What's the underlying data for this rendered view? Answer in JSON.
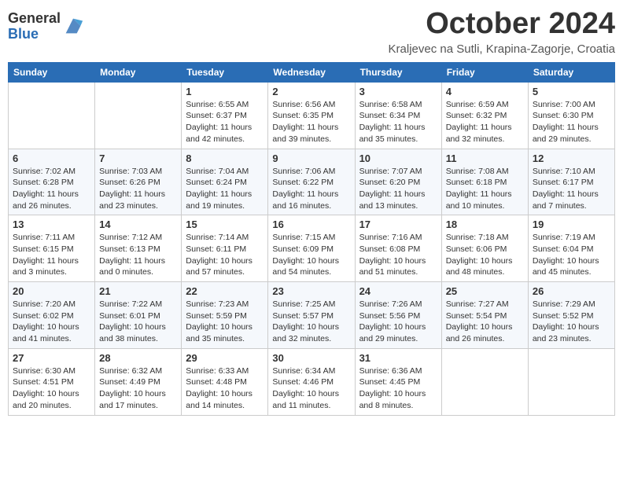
{
  "logo": {
    "general": "General",
    "blue": "Blue"
  },
  "title": "October 2024",
  "location": "Kraljevec na Sutli, Krapina-Zagorje, Croatia",
  "days_of_week": [
    "Sunday",
    "Monday",
    "Tuesday",
    "Wednesday",
    "Thursday",
    "Friday",
    "Saturday"
  ],
  "weeks": [
    [
      {
        "day": "",
        "info": ""
      },
      {
        "day": "",
        "info": ""
      },
      {
        "day": "1",
        "sunrise": "Sunrise: 6:55 AM",
        "sunset": "Sunset: 6:37 PM",
        "daylight": "Daylight: 11 hours and 42 minutes."
      },
      {
        "day": "2",
        "sunrise": "Sunrise: 6:56 AM",
        "sunset": "Sunset: 6:35 PM",
        "daylight": "Daylight: 11 hours and 39 minutes."
      },
      {
        "day": "3",
        "sunrise": "Sunrise: 6:58 AM",
        "sunset": "Sunset: 6:34 PM",
        "daylight": "Daylight: 11 hours and 35 minutes."
      },
      {
        "day": "4",
        "sunrise": "Sunrise: 6:59 AM",
        "sunset": "Sunset: 6:32 PM",
        "daylight": "Daylight: 11 hours and 32 minutes."
      },
      {
        "day": "5",
        "sunrise": "Sunrise: 7:00 AM",
        "sunset": "Sunset: 6:30 PM",
        "daylight": "Daylight: 11 hours and 29 minutes."
      }
    ],
    [
      {
        "day": "6",
        "sunrise": "Sunrise: 7:02 AM",
        "sunset": "Sunset: 6:28 PM",
        "daylight": "Daylight: 11 hours and 26 minutes."
      },
      {
        "day": "7",
        "sunrise": "Sunrise: 7:03 AM",
        "sunset": "Sunset: 6:26 PM",
        "daylight": "Daylight: 11 hours and 23 minutes."
      },
      {
        "day": "8",
        "sunrise": "Sunrise: 7:04 AM",
        "sunset": "Sunset: 6:24 PM",
        "daylight": "Daylight: 11 hours and 19 minutes."
      },
      {
        "day": "9",
        "sunrise": "Sunrise: 7:06 AM",
        "sunset": "Sunset: 6:22 PM",
        "daylight": "Daylight: 11 hours and 16 minutes."
      },
      {
        "day": "10",
        "sunrise": "Sunrise: 7:07 AM",
        "sunset": "Sunset: 6:20 PM",
        "daylight": "Daylight: 11 hours and 13 minutes."
      },
      {
        "day": "11",
        "sunrise": "Sunrise: 7:08 AM",
        "sunset": "Sunset: 6:18 PM",
        "daylight": "Daylight: 11 hours and 10 minutes."
      },
      {
        "day": "12",
        "sunrise": "Sunrise: 7:10 AM",
        "sunset": "Sunset: 6:17 PM",
        "daylight": "Daylight: 11 hours and 7 minutes."
      }
    ],
    [
      {
        "day": "13",
        "sunrise": "Sunrise: 7:11 AM",
        "sunset": "Sunset: 6:15 PM",
        "daylight": "Daylight: 11 hours and 3 minutes."
      },
      {
        "day": "14",
        "sunrise": "Sunrise: 7:12 AM",
        "sunset": "Sunset: 6:13 PM",
        "daylight": "Daylight: 11 hours and 0 minutes."
      },
      {
        "day": "15",
        "sunrise": "Sunrise: 7:14 AM",
        "sunset": "Sunset: 6:11 PM",
        "daylight": "Daylight: 10 hours and 57 minutes."
      },
      {
        "day": "16",
        "sunrise": "Sunrise: 7:15 AM",
        "sunset": "Sunset: 6:09 PM",
        "daylight": "Daylight: 10 hours and 54 minutes."
      },
      {
        "day": "17",
        "sunrise": "Sunrise: 7:16 AM",
        "sunset": "Sunset: 6:08 PM",
        "daylight": "Daylight: 10 hours and 51 minutes."
      },
      {
        "day": "18",
        "sunrise": "Sunrise: 7:18 AM",
        "sunset": "Sunset: 6:06 PM",
        "daylight": "Daylight: 10 hours and 48 minutes."
      },
      {
        "day": "19",
        "sunrise": "Sunrise: 7:19 AM",
        "sunset": "Sunset: 6:04 PM",
        "daylight": "Daylight: 10 hours and 45 minutes."
      }
    ],
    [
      {
        "day": "20",
        "sunrise": "Sunrise: 7:20 AM",
        "sunset": "Sunset: 6:02 PM",
        "daylight": "Daylight: 10 hours and 41 minutes."
      },
      {
        "day": "21",
        "sunrise": "Sunrise: 7:22 AM",
        "sunset": "Sunset: 6:01 PM",
        "daylight": "Daylight: 10 hours and 38 minutes."
      },
      {
        "day": "22",
        "sunrise": "Sunrise: 7:23 AM",
        "sunset": "Sunset: 5:59 PM",
        "daylight": "Daylight: 10 hours and 35 minutes."
      },
      {
        "day": "23",
        "sunrise": "Sunrise: 7:25 AM",
        "sunset": "Sunset: 5:57 PM",
        "daylight": "Daylight: 10 hours and 32 minutes."
      },
      {
        "day": "24",
        "sunrise": "Sunrise: 7:26 AM",
        "sunset": "Sunset: 5:56 PM",
        "daylight": "Daylight: 10 hours and 29 minutes."
      },
      {
        "day": "25",
        "sunrise": "Sunrise: 7:27 AM",
        "sunset": "Sunset: 5:54 PM",
        "daylight": "Daylight: 10 hours and 26 minutes."
      },
      {
        "day": "26",
        "sunrise": "Sunrise: 7:29 AM",
        "sunset": "Sunset: 5:52 PM",
        "daylight": "Daylight: 10 hours and 23 minutes."
      }
    ],
    [
      {
        "day": "27",
        "sunrise": "Sunrise: 6:30 AM",
        "sunset": "Sunset: 4:51 PM",
        "daylight": "Daylight: 10 hours and 20 minutes."
      },
      {
        "day": "28",
        "sunrise": "Sunrise: 6:32 AM",
        "sunset": "Sunset: 4:49 PM",
        "daylight": "Daylight: 10 hours and 17 minutes."
      },
      {
        "day": "29",
        "sunrise": "Sunrise: 6:33 AM",
        "sunset": "Sunset: 4:48 PM",
        "daylight": "Daylight: 10 hours and 14 minutes."
      },
      {
        "day": "30",
        "sunrise": "Sunrise: 6:34 AM",
        "sunset": "Sunset: 4:46 PM",
        "daylight": "Daylight: 10 hours and 11 minutes."
      },
      {
        "day": "31",
        "sunrise": "Sunrise: 6:36 AM",
        "sunset": "Sunset: 4:45 PM",
        "daylight": "Daylight: 10 hours and 8 minutes."
      },
      {
        "day": "",
        "info": ""
      },
      {
        "day": "",
        "info": ""
      }
    ]
  ]
}
